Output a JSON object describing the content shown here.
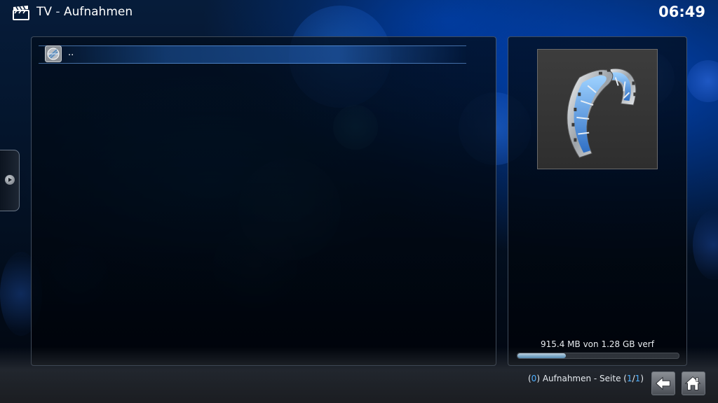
{
  "header": {
    "section": "TV",
    "separator": " - ",
    "page": "Aufnahmen",
    "clock": "06:49",
    "icon": "clapperboard-icon"
  },
  "list": {
    "items": [
      {
        "label": "..",
        "icon": "parent-folder-icon"
      }
    ]
  },
  "info_panel": {
    "thumbnail_icon": "film-reel-icon",
    "storage_text": "915.4 MB von 1.28 GB verf",
    "storage_fraction": 0.3
  },
  "footer": {
    "count_open": "(",
    "count": "0",
    "count_close": ")",
    "label": " Aufnahmen - Seite (",
    "page_current": "1",
    "page_sep": "/",
    "page_total": "1",
    "page_close": ")"
  },
  "controls": {
    "back_icon": "back-arrow-icon",
    "home_icon": "home-icon",
    "side_tab_icon": "play-arrow-icon"
  },
  "colors": {
    "accent": "#4fb0ff",
    "text": "#ffffff"
  }
}
